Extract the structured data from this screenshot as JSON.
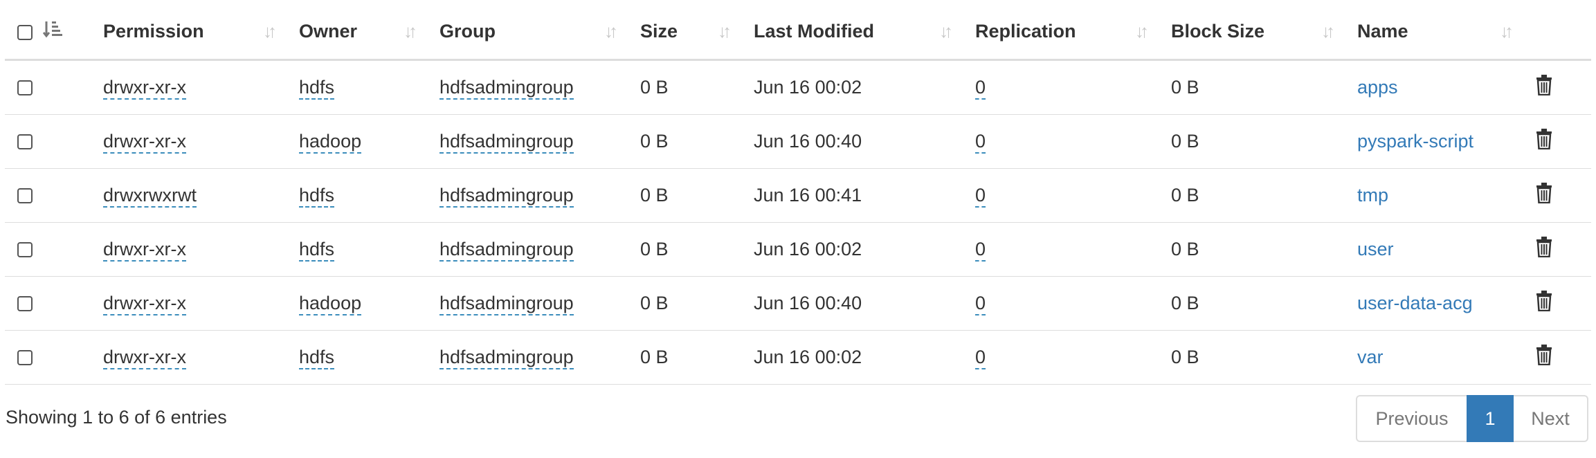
{
  "table": {
    "columns": {
      "permission": "Permission",
      "owner": "Owner",
      "group": "Group",
      "size": "Size",
      "last_modified": "Last Modified",
      "replication": "Replication",
      "block_size": "Block Size",
      "name": "Name"
    },
    "rows": [
      {
        "permission": "drwxr-xr-x",
        "owner": "hdfs",
        "group": "hdfsadmingroup",
        "size": "0 B",
        "last_modified": "Jun 16 00:02",
        "replication": "0",
        "block_size": "0 B",
        "name": "apps"
      },
      {
        "permission": "drwxr-xr-x",
        "owner": "hadoop",
        "group": "hdfsadmingroup",
        "size": "0 B",
        "last_modified": "Jun 16 00:40",
        "replication": "0",
        "block_size": "0 B",
        "name": "pyspark-script"
      },
      {
        "permission": "drwxrwxrwt",
        "owner": "hdfs",
        "group": "hdfsadmingroup",
        "size": "0 B",
        "last_modified": "Jun 16 00:41",
        "replication": "0",
        "block_size": "0 B",
        "name": "tmp"
      },
      {
        "permission": "drwxr-xr-x",
        "owner": "hdfs",
        "group": "hdfsadmingroup",
        "size": "0 B",
        "last_modified": "Jun 16 00:02",
        "replication": "0",
        "block_size": "0 B",
        "name": "user"
      },
      {
        "permission": "drwxr-xr-x",
        "owner": "hadoop",
        "group": "hdfsadmingroup",
        "size": "0 B",
        "last_modified": "Jun 16 00:40",
        "replication": "0",
        "block_size": "0 B",
        "name": "user-data-acg"
      },
      {
        "permission": "drwxr-xr-x",
        "owner": "hdfs",
        "group": "hdfsadmingroup",
        "size": "0 B",
        "last_modified": "Jun 16 00:02",
        "replication": "0",
        "block_size": "0 B",
        "name": "var"
      }
    ]
  },
  "footer": {
    "info": "Showing 1 to 6 of 6 entries"
  },
  "pagination": {
    "previous": "Previous",
    "current": "1",
    "next": "Next"
  },
  "icons": {
    "sort": "sort-icon",
    "sort_active": "sort-amount-down-icon",
    "delete": "trash-icon"
  },
  "colors": {
    "link": "#337ab7",
    "active_page": "#337ab7",
    "border": "#dddddd",
    "dashed_underline": "#3c8dbc"
  }
}
